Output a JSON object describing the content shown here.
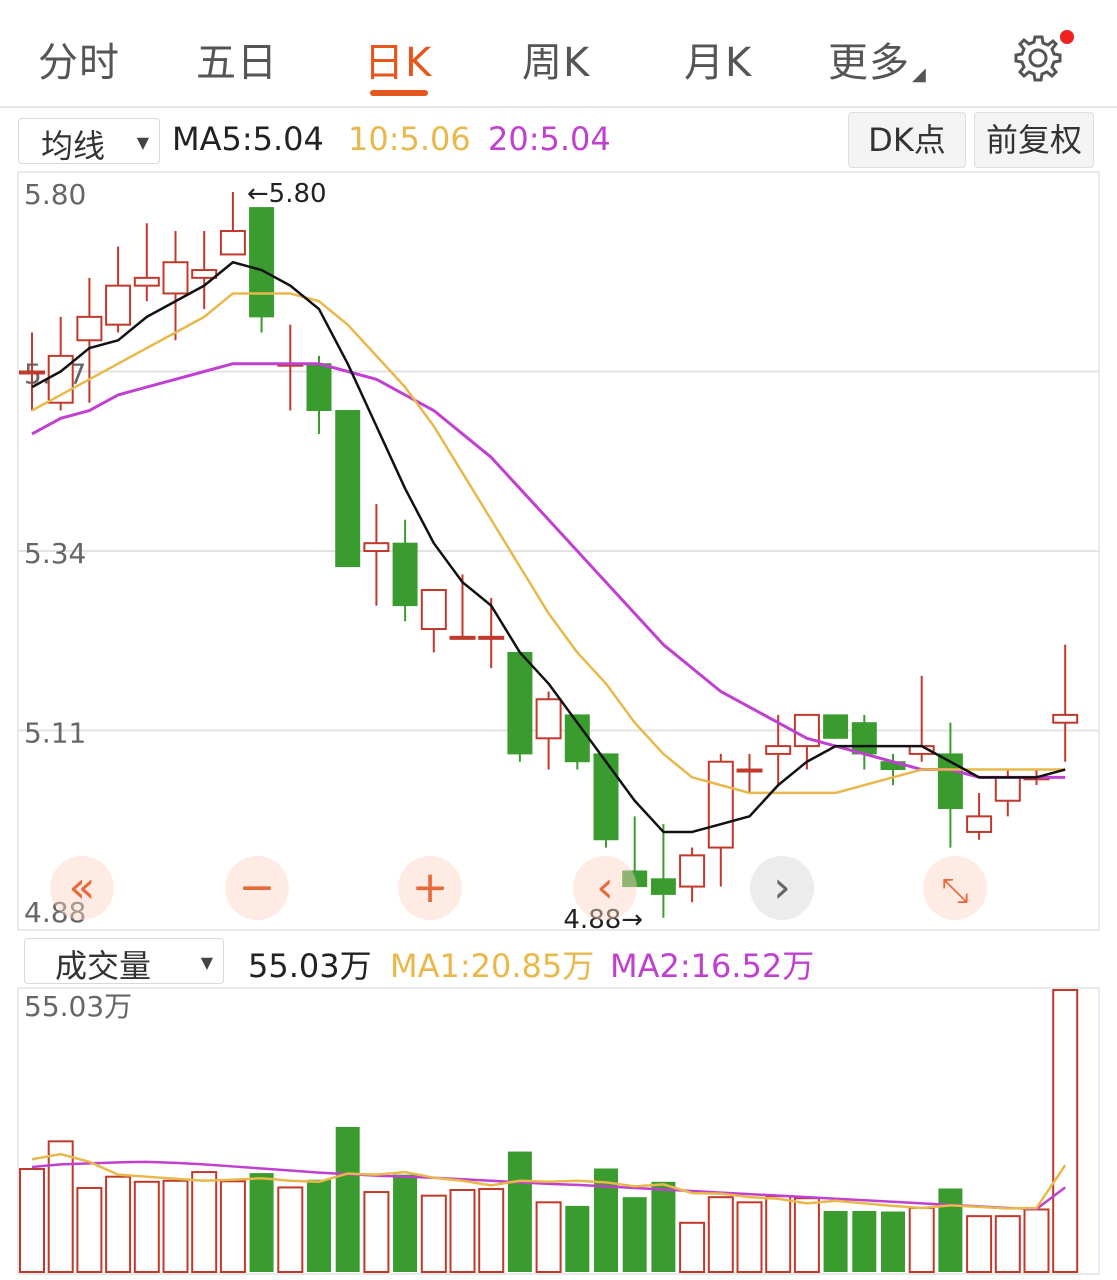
{
  "tabs": [
    {
      "label": "分时",
      "active": false
    },
    {
      "label": "五日",
      "active": false
    },
    {
      "label": "日K",
      "active": true
    },
    {
      "label": "周K",
      "active": false
    },
    {
      "label": "月K",
      "active": false
    },
    {
      "label": "更多",
      "active": false
    }
  ],
  "toolbar": {
    "indicator_select": "均线",
    "ma5": "MA5:5.04",
    "ma10": "10:5.06",
    "ma20": "20:5.04",
    "dk_button": "DK点",
    "adjust_button": "前复权"
  },
  "volume_toolbar": {
    "select": "成交量",
    "current": "55.03万",
    "ma1": "MA1:20.85万",
    "ma2": "MA2:16.52万"
  },
  "colors": {
    "accent": "#e5551e",
    "up": "#c0392b",
    "down": "#3a9c2f",
    "ma5": "#111111",
    "ma10": "#e8b84a",
    "ma20": "#c040d0"
  },
  "icons": [
    "settings-gear-icon",
    "double-left-icon",
    "zoom-out-icon",
    "zoom-in-icon",
    "left-arrow-icon",
    "right-arrow-icon",
    "fullscreen-icon"
  ],
  "chart_data": [
    {
      "type": "candlestick",
      "title": "",
      "y_ticks": [
        "5.80",
        "5.57",
        "5.34",
        "5.11",
        "4.88"
      ],
      "ylim": [
        4.88,
        5.8
      ],
      "max_label": "5.80",
      "min_label": "4.88",
      "candles": [
        {
          "o": 5.57,
          "h": 5.62,
          "l": 5.52,
          "c": 5.57
        },
        {
          "o": 5.53,
          "h": 5.64,
          "l": 5.52,
          "c": 5.59
        },
        {
          "o": 5.61,
          "h": 5.69,
          "l": 5.53,
          "c": 5.64
        },
        {
          "o": 5.63,
          "h": 5.73,
          "l": 5.62,
          "c": 5.68
        },
        {
          "o": 5.68,
          "h": 5.76,
          "l": 5.66,
          "c": 5.69
        },
        {
          "o": 5.67,
          "h": 5.75,
          "l": 5.61,
          "c": 5.71
        },
        {
          "o": 5.69,
          "h": 5.75,
          "l": 5.65,
          "c": 5.7
        },
        {
          "o": 5.72,
          "h": 5.8,
          "l": 5.72,
          "c": 5.75
        },
        {
          "o": 5.78,
          "h": 5.78,
          "l": 5.62,
          "c": 5.64
        },
        {
          "o": 5.58,
          "h": 5.63,
          "l": 5.52,
          "c": 5.58
        },
        {
          "o": 5.58,
          "h": 5.59,
          "l": 5.49,
          "c": 5.52
        },
        {
          "o": 5.52,
          "h": 5.52,
          "l": 5.32,
          "c": 5.32
        },
        {
          "o": 5.34,
          "h": 5.4,
          "l": 5.27,
          "c": 5.35
        },
        {
          "o": 5.35,
          "h": 5.38,
          "l": 5.25,
          "c": 5.27
        },
        {
          "o": 5.24,
          "h": 5.29,
          "l": 5.21,
          "c": 5.29
        },
        {
          "o": 5.23,
          "h": 5.31,
          "l": 5.23,
          "c": 5.23
        },
        {
          "o": 5.23,
          "h": 5.28,
          "l": 5.19,
          "c": 5.23
        },
        {
          "o": 5.21,
          "h": 5.21,
          "l": 5.07,
          "c": 5.08
        },
        {
          "o": 5.1,
          "h": 5.16,
          "l": 5.06,
          "c": 5.15
        },
        {
          "o": 5.13,
          "h": 5.13,
          "l": 5.06,
          "c": 5.07
        },
        {
          "o": 5.08,
          "h": 5.08,
          "l": 4.96,
          "c": 4.97
        },
        {
          "o": 4.93,
          "h": 5.0,
          "l": 4.91,
          "c": 4.91
        },
        {
          "o": 4.92,
          "h": 4.99,
          "l": 4.87,
          "c": 4.9
        },
        {
          "o": 4.91,
          "h": 4.96,
          "l": 4.89,
          "c": 4.95
        },
        {
          "o": 4.96,
          "h": 5.08,
          "l": 4.91,
          "c": 5.07
        },
        {
          "o": 5.06,
          "h": 5.08,
          "l": 5.03,
          "c": 5.06
        },
        {
          "o": 5.08,
          "h": 5.13,
          "l": 5.04,
          "c": 5.09
        },
        {
          "o": 5.09,
          "h": 5.13,
          "l": 5.06,
          "c": 5.13
        },
        {
          "o": 5.13,
          "h": 5.13,
          "l": 5.1,
          "c": 5.1
        },
        {
          "o": 5.12,
          "h": 5.13,
          "l": 5.06,
          "c": 5.08
        },
        {
          "o": 5.07,
          "h": 5.08,
          "l": 5.04,
          "c": 5.06
        },
        {
          "o": 5.08,
          "h": 5.18,
          "l": 5.07,
          "c": 5.09
        },
        {
          "o": 5.08,
          "h": 5.12,
          "l": 4.96,
          "c": 5.01
        },
        {
          "o": 4.98,
          "h": 5.03,
          "l": 4.97,
          "c": 5.0
        },
        {
          "o": 5.02,
          "h": 5.06,
          "l": 5.0,
          "c": 5.05
        },
        {
          "o": 5.05,
          "h": 5.06,
          "l": 5.04,
          "c": 5.05
        },
        {
          "o": 5.12,
          "h": 5.22,
          "l": 5.07,
          "c": 5.13
        }
      ],
      "ma5": [
        5.55,
        5.57,
        5.6,
        5.61,
        5.64,
        5.66,
        5.68,
        5.71,
        5.7,
        5.68,
        5.65,
        5.58,
        5.5,
        5.42,
        5.35,
        5.3,
        5.27,
        5.21,
        5.17,
        5.12,
        5.07,
        5.02,
        4.98,
        4.98,
        4.99,
        5.0,
        5.04,
        5.07,
        5.09,
        5.09,
        5.09,
        5.09,
        5.07,
        5.05,
        5.05,
        5.05,
        5.06
      ],
      "ma10": [
        5.52,
        5.54,
        5.56,
        5.58,
        5.6,
        5.62,
        5.64,
        5.67,
        5.67,
        5.67,
        5.66,
        5.63,
        5.59,
        5.55,
        5.5,
        5.44,
        5.38,
        5.32,
        5.26,
        5.21,
        5.17,
        5.12,
        5.08,
        5.05,
        5.04,
        5.03,
        5.03,
        5.03,
        5.03,
        5.04,
        5.05,
        5.06,
        5.06,
        5.06,
        5.06,
        5.06,
        5.06
      ],
      "ma20": [
        5.49,
        5.51,
        5.52,
        5.54,
        5.55,
        5.56,
        5.57,
        5.58,
        5.58,
        5.58,
        5.58,
        5.57,
        5.56,
        5.54,
        5.52,
        5.49,
        5.46,
        5.42,
        5.38,
        5.34,
        5.3,
        5.26,
        5.22,
        5.19,
        5.16,
        5.14,
        5.12,
        5.1,
        5.09,
        5.08,
        5.07,
        5.06,
        5.06,
        5.05,
        5.05,
        5.05,
        5.05
      ]
    },
    {
      "type": "bar",
      "title": "",
      "y_label": "55.03万",
      "unit": "万",
      "ylim": [
        0,
        55.03
      ],
      "values": [
        20.1,
        25.5,
        16.4,
        18.6,
        17.6,
        17.8,
        19.5,
        17.7,
        19.3,
        16.5,
        18.0,
        28.3,
        15.6,
        19.0,
        14.9,
        16.0,
        16.2,
        23.5,
        13.6,
        12.9,
        20.2,
        14.6,
        17.6,
        9.6,
        14.6,
        13.6,
        14.8,
        14.4,
        11.9,
        11.9,
        11.8,
        12.5,
        16.3,
        10.9,
        10.9,
        12.2,
        55.03
      ],
      "ma1": [
        22.0,
        23.0,
        21.5,
        19.0,
        18.6,
        18.2,
        17.8,
        18.0,
        18.3,
        17.8,
        17.6,
        19.2,
        19.0,
        19.5,
        18.4,
        17.8,
        16.9,
        17.8,
        17.6,
        17.8,
        17.5,
        16.7,
        17.1,
        15.4,
        15.3,
        14.6,
        14.3,
        13.4,
        13.9,
        13.4,
        12.9,
        12.5,
        13.0,
        12.7,
        12.4,
        12.5,
        20.85
      ],
      "ma2": [
        20.5,
        21.0,
        21.2,
        21.4,
        21.5,
        21.3,
        21.0,
        20.6,
        20.2,
        19.8,
        19.4,
        19.1,
        18.8,
        18.6,
        18.4,
        18.1,
        17.8,
        17.5,
        17.2,
        17.0,
        16.7,
        16.4,
        16.1,
        15.8,
        15.5,
        15.2,
        14.9,
        14.6,
        14.3,
        14.0,
        13.7,
        13.4,
        13.1,
        12.8,
        12.5,
        12.3,
        16.52
      ]
    }
  ]
}
